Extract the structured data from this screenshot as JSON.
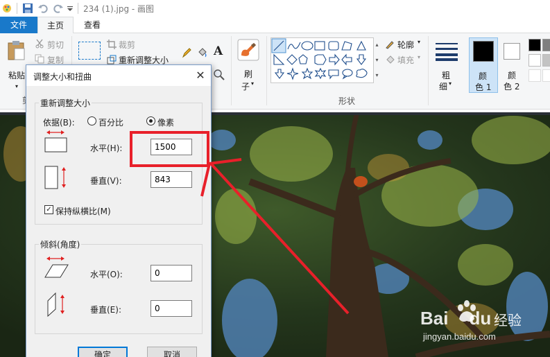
{
  "window": {
    "title": "234 (1).jpg - 画图"
  },
  "tabs": [
    {
      "label": "文件"
    },
    {
      "label": "主页"
    },
    {
      "label": "查看"
    }
  ],
  "ribbon": {
    "clipboard": {
      "paste": "粘贴",
      "cut": "剪切",
      "copy": "复制",
      "group_label": "剪"
    },
    "image": {
      "crop": "裁剪",
      "resize": "重新调整大小"
    },
    "tools": {
      "text_tool": "A"
    },
    "brushes": {
      "label_line1": "刷",
      "label_line2": "子"
    },
    "shapes": {
      "group_label": "形状",
      "outline": "轮廓",
      "fill": "填充"
    },
    "size": {
      "line1": "粗",
      "line2": "细"
    },
    "color1": {
      "line1": "颜",
      "line2": "色 1"
    },
    "color2": {
      "line1": "颜",
      "line2": "色 2"
    }
  },
  "dialog": {
    "title": "调整大小和扭曲",
    "resize_group": "重新调整大小",
    "by_label": "依据(B):",
    "percent_label": "百分比",
    "pixels_label": "像素",
    "selected_unit": "pixels",
    "horizontal_label": "水平(H):",
    "horizontal_value": "1500",
    "vertical_label": "垂直(V):",
    "vertical_value": "843",
    "keep_ratio_label": "保持纵横比(M)",
    "keep_ratio_checked": true,
    "skew_group": "倾斜(角度)",
    "skew_h_label": "水平(O):",
    "skew_h_value": "0",
    "skew_v_label": "垂直(E):",
    "skew_v_value": "0",
    "ok_label": "确定",
    "cancel_label": "取消"
  },
  "watermark": {
    "brand": "Bai",
    "brand2": "du",
    "suffix": "经验",
    "url": "jingyan.baidu.com"
  },
  "colors": {
    "accent": "#1979ca",
    "annotation": "#e8202a",
    "focus": "#0078d7"
  }
}
